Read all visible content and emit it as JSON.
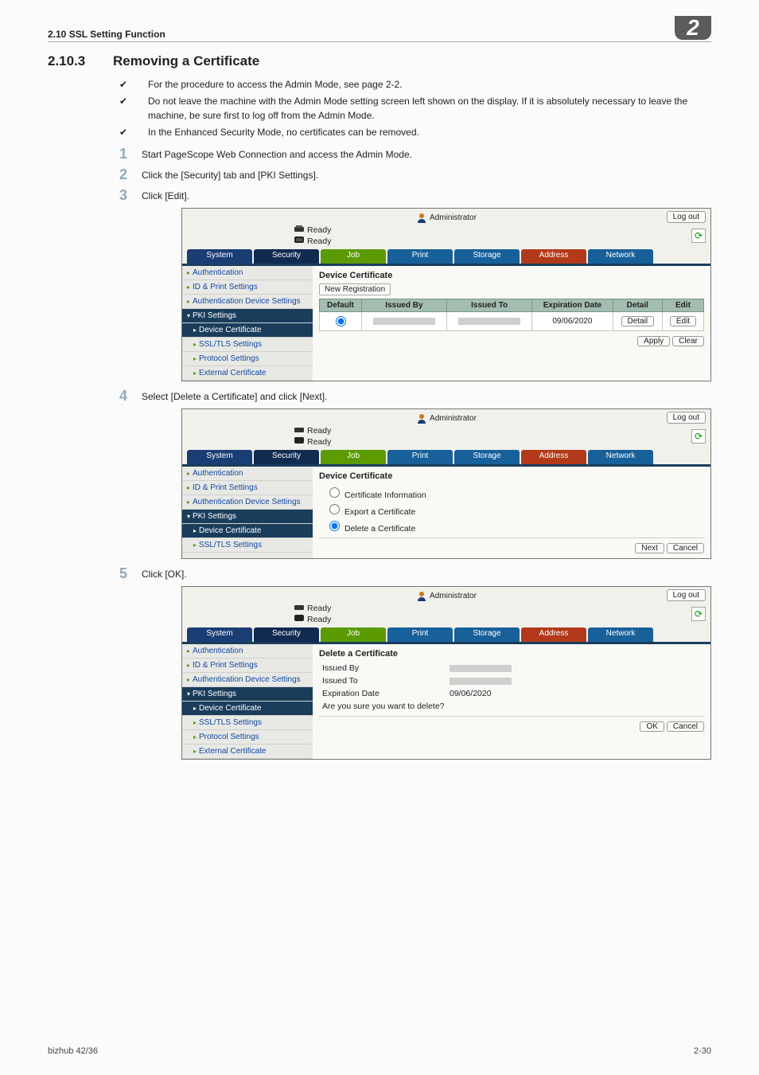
{
  "header": {
    "crumb": "2.10    SSL Setting Function",
    "badge": "2"
  },
  "section": {
    "num": "2.10.3",
    "title": "Removing a Certificate"
  },
  "notes": [
    "For the procedure to access the Admin Mode, see page 2-2.",
    "Do not leave the machine with the Admin Mode setting screen left shown on the display. If it is absolutely necessary to leave the machine, be sure first to log off from the Admin Mode.",
    "In the Enhanced Security Mode, no certificates can be removed."
  ],
  "steps": {
    "s1": "Start PageScope Web Connection and access the Admin Mode.",
    "s2": "Click the [Security] tab and [PKI Settings].",
    "s3": "Click [Edit].",
    "s4": "Select [Delete a Certificate] and click [Next].",
    "s5": "Click [OK]."
  },
  "console": {
    "adminLabel": "Administrator",
    "logout": "Log out",
    "ready": "Ready",
    "tabs": {
      "system": "System",
      "security": "Security",
      "job": "Job",
      "print": "Print",
      "storage": "Storage",
      "address": "Address",
      "network": "Network"
    },
    "sidebar": {
      "auth": "Authentication",
      "idprint": "ID & Print Settings",
      "authdev": "Authentication Device Settings",
      "pki": "PKI Settings",
      "devcert": "Device Certificate",
      "ssl": "SSL/TLS Settings",
      "proto": "Protocol Settings",
      "extcert": "External Certificate"
    }
  },
  "panel1": {
    "title": "Device Certificate",
    "newreg": "New Registration",
    "th": {
      "default": "Default",
      "issuedBy": "Issued By",
      "issuedTo": "Issued To",
      "exp": "Expiration Date",
      "detail": "Detail",
      "edit": "Edit"
    },
    "row": {
      "expDate": "09/06/2020",
      "detailBtn": "Detail",
      "editBtn": "Edit"
    },
    "applyBtn": "Apply",
    "clearBtn": "Clear"
  },
  "panel2": {
    "title": "Device Certificate",
    "optInfo": "Certificate Information",
    "optExport": "Export a Certificate",
    "optDelete": "Delete a Certificate",
    "nextBtn": "Next",
    "cancelBtn": "Cancel"
  },
  "panel3": {
    "title": "Delete a Certificate",
    "issuedBy": "Issued By",
    "issuedTo": "Issued To",
    "expLabel": "Expiration Date",
    "expVal": "09/06/2020",
    "confirm": "Are you sure you want to delete?",
    "okBtn": "OK",
    "cancelBtn": "Cancel"
  },
  "footer": {
    "left": "bizhub 42/36",
    "right": "2-30"
  }
}
